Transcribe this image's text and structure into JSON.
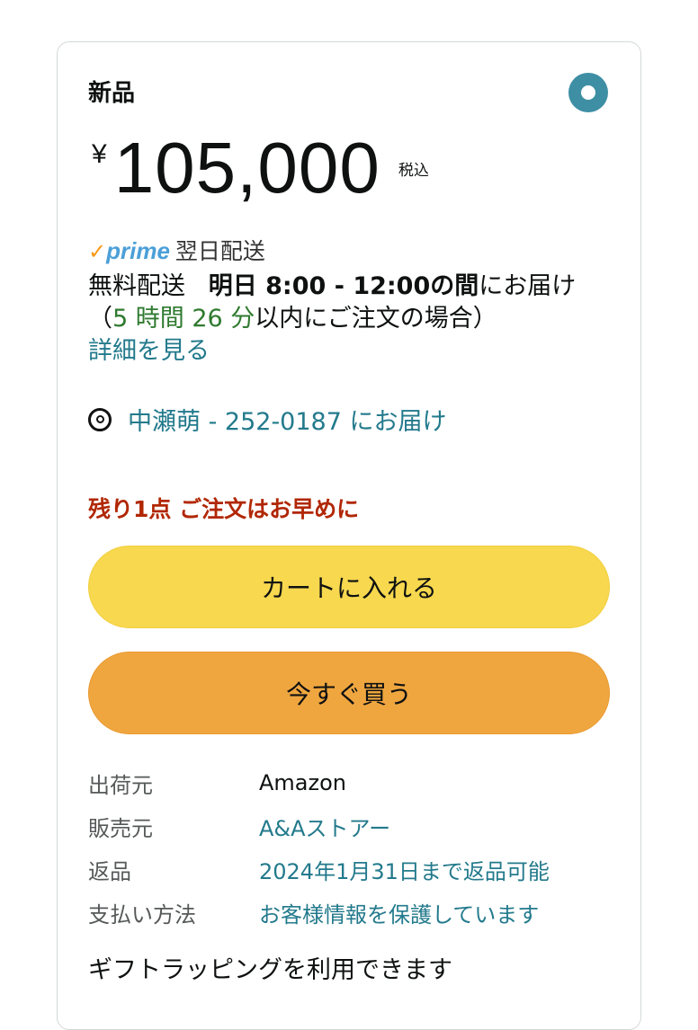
{
  "offer": {
    "condition": "新品",
    "currency_symbol": "¥",
    "price": "105,000",
    "tax_label": "税込"
  },
  "shipping": {
    "prime_check": "✓",
    "prime_word": "prime",
    "prime_speed": "翌日配送",
    "free_label": "無料配送",
    "date_window": "明日 8:00 - 12:00の間",
    "deliver_suffix": "にお届け（",
    "countdown": "5 時間 26 分",
    "countdown_suffix": "以内にご注文の場合）",
    "details_link": "詳細を見る"
  },
  "address": {
    "text": "中瀬萌 - 252-0187 にお届け"
  },
  "stock_notice": "残り1点 ご注文はお早めに",
  "buttons": {
    "add_to_cart": "カートに入れる",
    "buy_now": "今すぐ買う"
  },
  "info": [
    {
      "label": "出荷元",
      "value": "Amazon"
    },
    {
      "label": "販売元",
      "value": "A&Aストアー"
    },
    {
      "label": "返品",
      "value": "2024年1月31日まで返品可能"
    },
    {
      "label": "支払い方法",
      "value": "お客様情報を保護しています"
    }
  ],
  "gift_text": "ギフトラッピングを利用できます"
}
